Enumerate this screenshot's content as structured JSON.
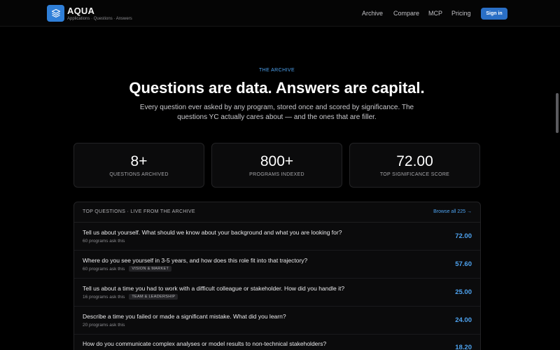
{
  "brand": {
    "name": "AQUA",
    "tagline": "Applications · Questions · Answers",
    "logo_icon": "stacked-layers-icon",
    "accent_color": "#2f7fd8"
  },
  "nav": {
    "links": [
      "Archive",
      "Compare",
      "MCP",
      "Pricing"
    ],
    "signin_label": "Sign in"
  },
  "hero": {
    "eyebrow": "THE ARCHIVE",
    "title": "Questions are data. Answers are capital.",
    "subtitle": "Every question ever asked by any program, stored once and scored by significance. The questions YC actually cares about — and the ones that are filler."
  },
  "stats": [
    {
      "value": "8+",
      "label": "QUESTIONS ARCHIVED"
    },
    {
      "value": "800+",
      "label": "PROGRAMS INDEXED"
    },
    {
      "value": "72.00",
      "label": "TOP SIGNIFICANCE SCORE"
    }
  ],
  "panel": {
    "title": "TOP QUESTIONS · LIVE FROM THE ARCHIVE",
    "browse_label": "Browse all 225 →",
    "questions": [
      {
        "text": "Tell us about yourself. What should we know about your background and what you are looking for?",
        "count": "60 programs ask this",
        "tag": "",
        "score": "72.00"
      },
      {
        "text": "Where do you see yourself in 3-5 years, and how does this role fit into that trajectory?",
        "count": "60 programs ask this",
        "tag": "VISION & MARKET",
        "score": "57.60"
      },
      {
        "text": "Tell us about a time you had to work with a difficult colleague or stakeholder. How did you handle it?",
        "count": "16 programs ask this",
        "tag": "TEAM & LEADERSHIP",
        "score": "25.00"
      },
      {
        "text": "Describe a time you failed or made a significant mistake. What did you learn?",
        "count": "20 programs ask this",
        "tag": "",
        "score": "24.00"
      },
      {
        "text": "How do you communicate complex analyses or model results to non-technical stakeholders?",
        "count": "",
        "tag": "",
        "score": "18.20"
      }
    ]
  }
}
